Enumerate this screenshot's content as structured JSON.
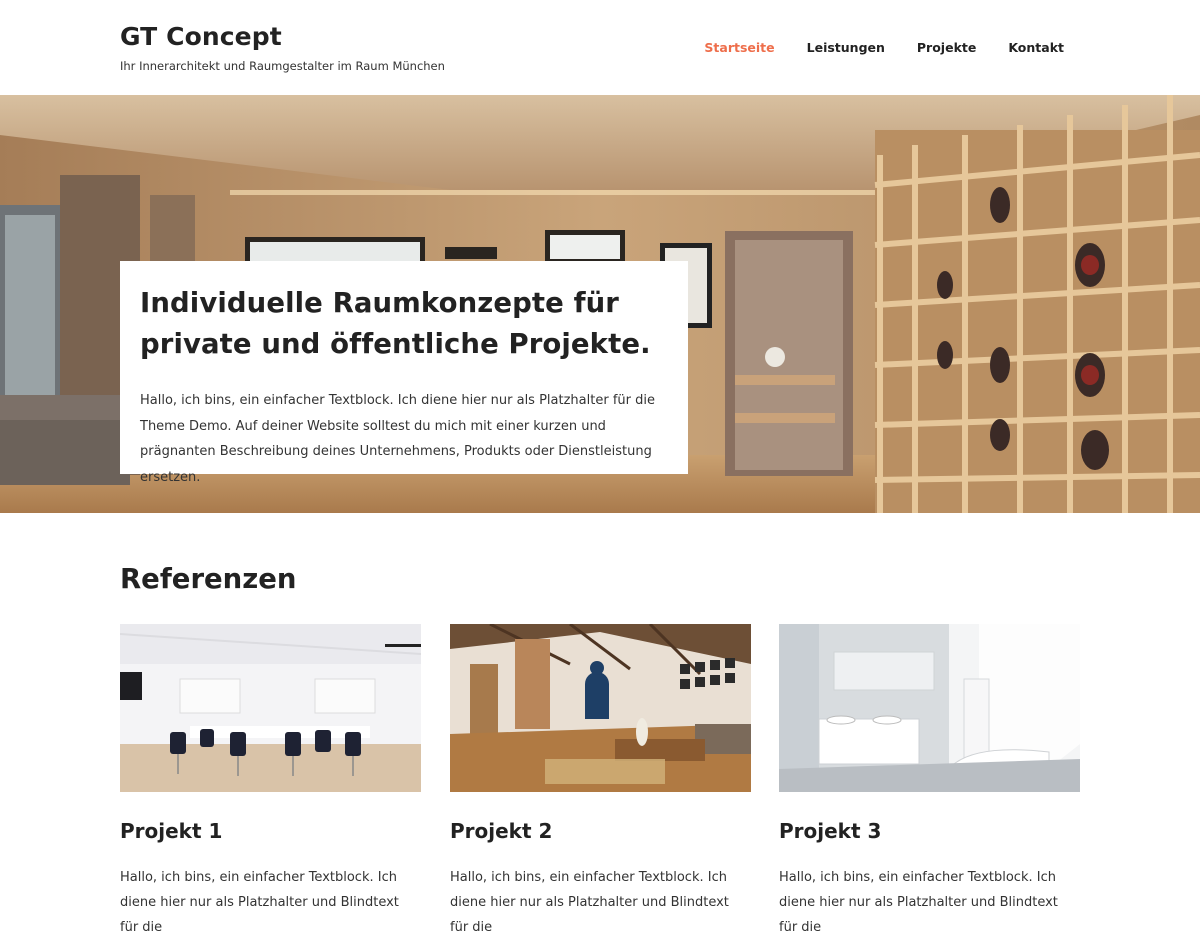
{
  "header": {
    "site_title": "GT Concept",
    "site_description": "Ihr Innerarchitekt und Raumgestalter im Raum München",
    "nav": [
      {
        "label": "Startseite",
        "active": true
      },
      {
        "label": "Leistungen",
        "active": false
      },
      {
        "label": "Projekte",
        "active": false
      },
      {
        "label": "Kontakt",
        "active": false
      }
    ]
  },
  "hero": {
    "title_line1": "Individuelle Raumkonzepte für",
    "title_line2": "private und öffentliche Projekte.",
    "text": "Hallo, ich bins, ein einfacher Textblock. Ich diene hier nur als Platzhalter für die Theme Demo. Auf deiner Website solltest du mich mit einer kurzen und prägnanten Beschreibung deines Unternehmens, Produkts oder Dienstleistung ersetzen."
  },
  "references": {
    "heading": "Referenzen",
    "cards": [
      {
        "title": "Projekt 1",
        "text": "Hallo, ich bins, ein einfacher Textblock. Ich diene hier nur als Platzhalter und Blindtext für die"
      },
      {
        "title": "Projekt 2",
        "text": "Hallo, ich bins, ein einfacher Textblock. Ich diene hier nur als Platzhalter und Blindtext für die"
      },
      {
        "title": "Projekt 3",
        "text": "Hallo, ich bins, ein einfacher Textblock. Ich diene hier nur als Platzhalter und Blindtext für die"
      }
    ]
  },
  "colors": {
    "accent": "#ee6e4b",
    "text": "#222222"
  }
}
